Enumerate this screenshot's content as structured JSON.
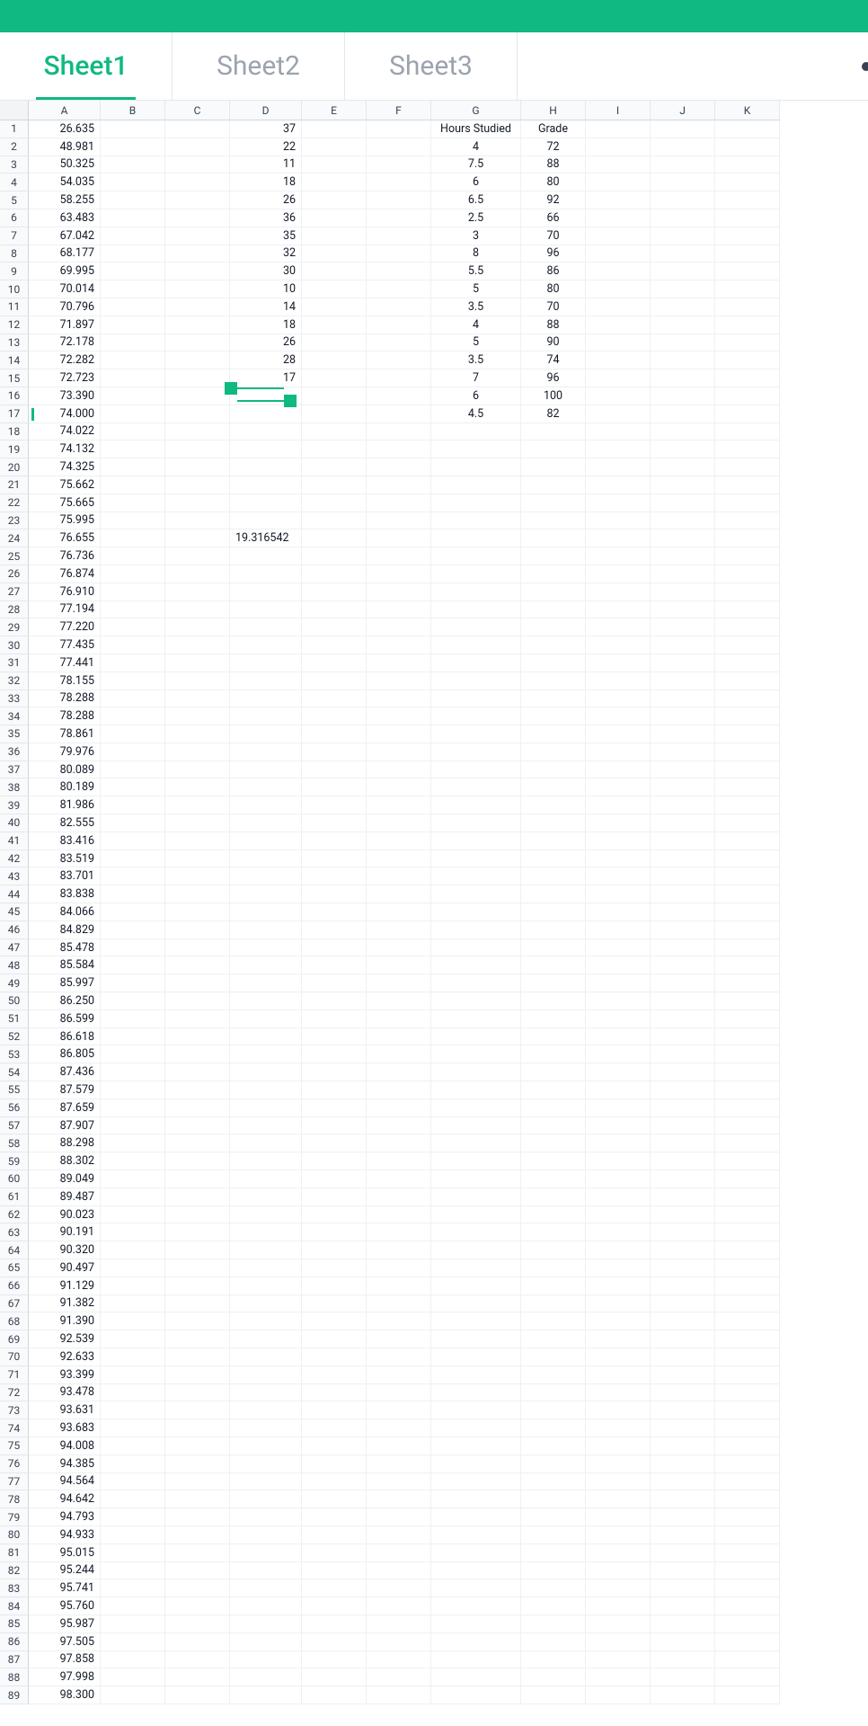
{
  "colors": {
    "accent": "#10b981"
  },
  "tabs": [
    "Sheet1",
    "Sheet2",
    "Sheet3"
  ],
  "active_tab": 0,
  "columns": [
    "A",
    "B",
    "C",
    "D",
    "E",
    "F",
    "G",
    "H",
    "I",
    "J",
    "K"
  ],
  "col_A": [
    "26.635",
    "48.981",
    "50.325",
    "54.035",
    "58.255",
    "63.483",
    "67.042",
    "68.177",
    "69.995",
    "70.014",
    "70.796",
    "71.897",
    "72.178",
    "72.282",
    "72.723",
    "73.390",
    "74.000",
    "74.022",
    "74.132",
    "74.325",
    "75.662",
    "75.665",
    "75.995",
    "76.655",
    "76.736",
    "76.874",
    "76.910",
    "77.194",
    "77.220",
    "77.435",
    "77.441",
    "78.155",
    "78.288",
    "78.288",
    "78.861",
    "79.976",
    "80.089",
    "80.189",
    "81.986",
    "82.555",
    "83.416",
    "83.519",
    "83.701",
    "83.838",
    "84.066",
    "84.829",
    "85.478",
    "85.584",
    "85.997",
    "86.250",
    "86.599",
    "86.618",
    "86.805",
    "87.436",
    "87.579",
    "87.659",
    "87.907",
    "88.298",
    "88.302",
    "89.049",
    "89.487",
    "90.023",
    "90.191",
    "90.320",
    "90.497",
    "91.129",
    "91.382",
    "91.390",
    "92.539",
    "92.633",
    "93.399",
    "93.478",
    "93.631",
    "93.683",
    "94.008",
    "94.385",
    "94.564",
    "94.642",
    "94.793",
    "94.933",
    "95.015",
    "95.244",
    "95.741",
    "95.760",
    "95.987",
    "97.505",
    "97.858",
    "97.998",
    "98.300"
  ],
  "col_D": {
    "1": "37",
    "2": "22",
    "3": "11",
    "4": "18",
    "5": "26",
    "6": "36",
    "7": "35",
    "8": "32",
    "9": "30",
    "10": "10",
    "11": "14",
    "12": "18",
    "13": "26",
    "14": "28",
    "15": "17",
    "24": "19.316542"
  },
  "col_G": {
    "1": "Hours Studied",
    "2": "4",
    "3": "7.5",
    "4": "6",
    "5": "6.5",
    "6": "2.5",
    "7": "3",
    "8": "8",
    "9": "5.5",
    "10": "5",
    "11": "3.5",
    "12": "4",
    "13": "5",
    "14": "3.5",
    "15": "7",
    "16": "6",
    "17": "4.5"
  },
  "col_H": {
    "1": "Grade",
    "2": "72",
    "3": "88",
    "4": "80",
    "5": "92",
    "6": "66",
    "7": "70",
    "8": "96",
    "9": "86",
    "10": "80",
    "11": "70",
    "12": "88",
    "13": "90",
    "14": "74",
    "15": "96",
    "16": "100",
    "17": "82"
  },
  "row_count": 89,
  "selection_overlay": {
    "top_row": 16,
    "col": "D"
  }
}
